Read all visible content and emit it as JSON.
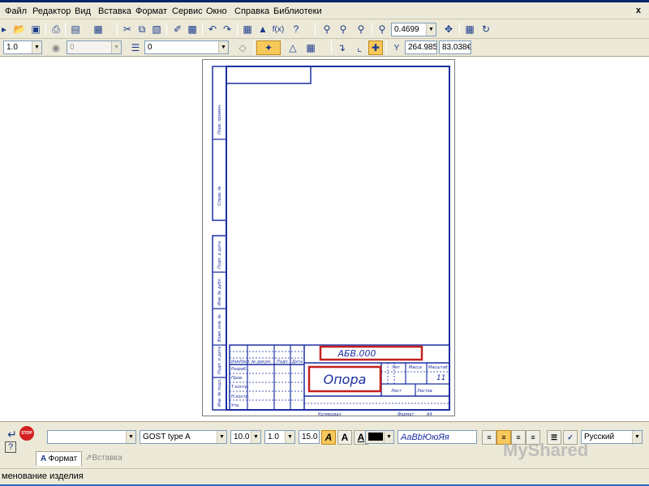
{
  "menu": [
    "Файл",
    "Редактор",
    "Вид",
    "Вставка",
    "Формат",
    "Сервис",
    "Окно",
    "Справка",
    "Библиотеки"
  ],
  "menu_mnemonic": [
    "Ф",
    "Р",
    "В",
    "В",
    "м",
    "С",
    "О",
    "С",
    "Б"
  ],
  "window_close": "x",
  "toolbar": {
    "zoom_value": "0.4699",
    "coord_y_label": "Y",
    "coord_x_value": "264.985",
    "coord_y_value": "83.038€",
    "fx_label": "f(x)"
  },
  "props_bar": {
    "line_scale": "1.0",
    "layer_field": "0",
    "style_field": "0"
  },
  "drawing": {
    "name": "Опора",
    "designation": "АБВ.000",
    "sheets": "11",
    "lit_label": "Лит",
    "mass_label": "Масса",
    "scale_label": "Масштаб",
    "sheet_label": "Лист",
    "sheets_label": "Листов",
    "changes_labels": [
      "Изм",
      "Лист",
      "№ докум.",
      "Подп.",
      "Дата"
    ],
    "roles": [
      "Разраб.",
      "Пров.",
      "Т.контр.",
      "Н.контр.",
      "Утв."
    ],
    "copied_label": "Копировал",
    "format_label": "Формат",
    "format_value": "А4",
    "side_labels": [
      "Перв. примен.",
      "Справ. №",
      "Подп. и дата",
      "Инв. № дубл.",
      "Взам. инв. №",
      "Подп. и дата",
      "Инв. № подл."
    ]
  },
  "text_panel": {
    "style_field": "",
    "font_name": "GOST type A",
    "font_size": "10.0",
    "line_spacing": "1.0",
    "char_width": "15.0",
    "color_hex": "#000000",
    "sample_text": "АаBbЮюЯя",
    "language": "Русский",
    "tab_format": "Формат",
    "tab_insert": "Вставка",
    "stop_label": "STOP"
  },
  "status": {
    "text": "менование изделия"
  },
  "watermark": "MyShared",
  "colors": {
    "drawing_blue": "#1a2fa0",
    "highlight_red": "#c42020",
    "toolbar_bg": "#ece9d8",
    "title_blue": "#0a246a"
  }
}
